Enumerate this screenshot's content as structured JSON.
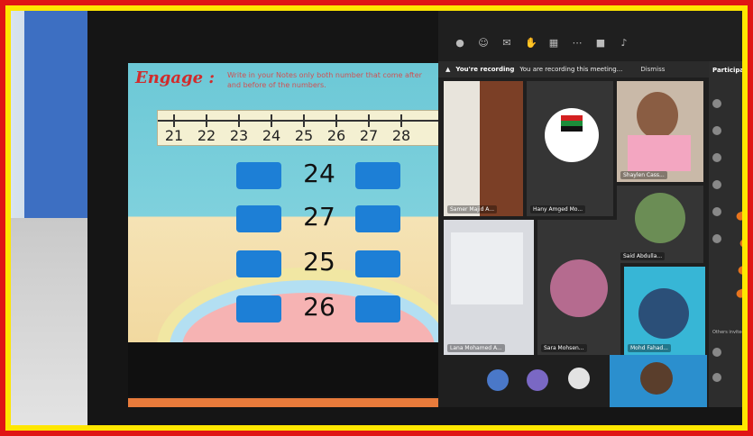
{
  "slide": {
    "title": "Engage :",
    "instruction": "Write in your Notes only both number that come after and before of the numbers.",
    "number_line": [
      "21",
      "22",
      "23",
      "24",
      "25",
      "26",
      "27",
      "28"
    ],
    "rows": [
      "24",
      "27",
      "25",
      "26"
    ]
  },
  "teams": {
    "recording_label": "You're recording",
    "recording_text": "You are recording this meeting...",
    "dismiss_label": "Dismiss",
    "participants_title": "Participants",
    "others_label": "Others invited",
    "tiles": [
      {
        "name": "Samer Majid A..."
      },
      {
        "name": "Hany Amged Mo..."
      },
      {
        "name": "Shaylen Cass..."
      },
      {
        "name": "Said Abdulla..."
      },
      {
        "name": "Lana Mohamed A..."
      },
      {
        "name": "Sara Mohsen..."
      },
      {
        "name": "Mohd Fahad..."
      }
    ]
  },
  "colors": {
    "outer_border": "#e01515",
    "inner_border": "#ffe600",
    "accent_blue": "#1d7fd6"
  }
}
